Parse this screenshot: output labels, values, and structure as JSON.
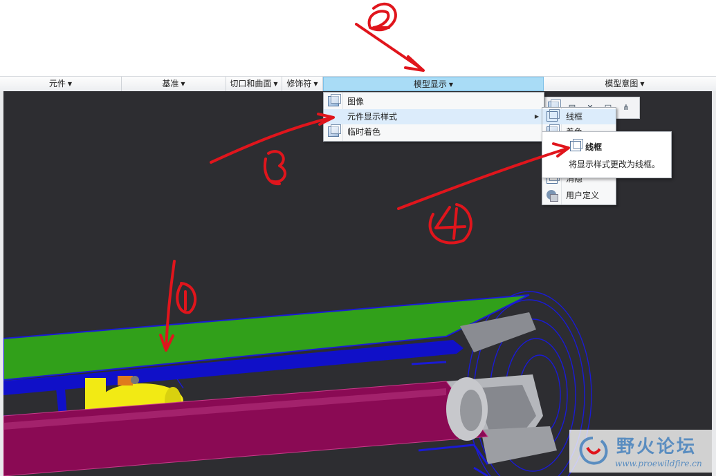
{
  "ribbon": {
    "groups": [
      {
        "label": "元件"
      },
      {
        "label": "基准"
      },
      {
        "label": "切口和曲面"
      },
      {
        "label": "修饰符"
      },
      {
        "label": "模型显示"
      },
      {
        "label": "模型意图"
      }
    ],
    "active_group": "模型显示"
  },
  "model_display_menu": {
    "items": [
      {
        "label": "图像",
        "icon": "image-icon"
      },
      {
        "label": "元件显示样式",
        "icon": "display-style-icon",
        "has_submenu": true,
        "highlighted": true
      },
      {
        "label": "临时着色",
        "icon": "temp-shading-icon"
      }
    ]
  },
  "display_style_submenu": {
    "items": [
      {
        "label": "线框",
        "icon": "wireframe-icon",
        "highlighted": true
      },
      {
        "label": "着色",
        "icon": "shading-icon"
      },
      {
        "label": "",
        "icon": "hidden-line-icon"
      },
      {
        "label": "",
        "icon": "no-hidden-icon"
      },
      {
        "label": "消隐",
        "icon": "hidden-icon"
      },
      {
        "label": "用户定义",
        "icon": "user-defined-icon"
      }
    ]
  },
  "tooltip": {
    "title": "线框",
    "description": "将显示样式更改为线框。",
    "icon": "wireframe-icon"
  },
  "watermark": {
    "title": "野火论坛",
    "url": "www.proewildfire.cn"
  },
  "colors": {
    "viewport_bg": "#2d2d31",
    "annotation_red": "#e0151c",
    "active_group_bg": "#a9dcf6",
    "highlight_bg": "#dcecfb",
    "green_part": "#31a01a",
    "magenta_part": "#8a0a54",
    "yellow_part": "#f2ea14",
    "wire_blue": "#1a1ad6"
  }
}
